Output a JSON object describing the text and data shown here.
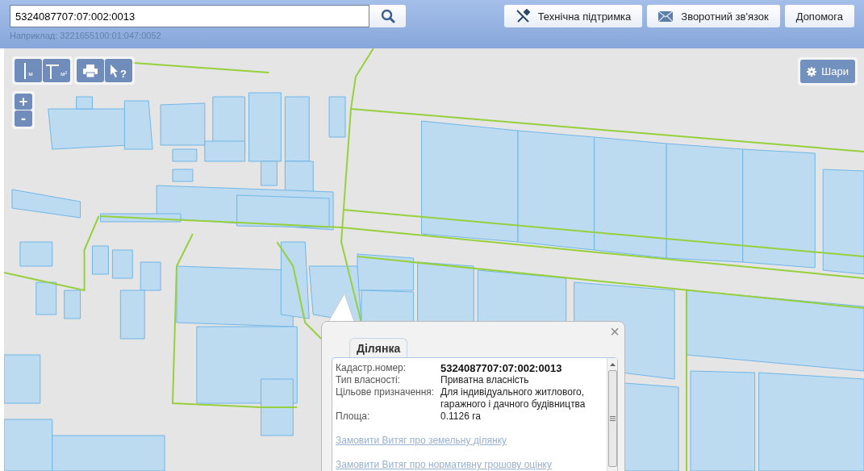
{
  "search": {
    "value": "5324087707:07:002:0013",
    "hint": "Наприклад: 3221655100:01:047:0052"
  },
  "header_buttons": [
    {
      "label": "Технічна підтримка",
      "kind": "tools"
    },
    {
      "label": "Зворотний зв'язок",
      "kind": "mail"
    },
    {
      "label": "Допомога",
      "kind": "plain"
    }
  ],
  "map_tools": [
    {
      "kind": "measure-length",
      "label": "м"
    },
    {
      "kind": "measure-area",
      "label": "м²"
    },
    {
      "kind": "print"
    },
    {
      "kind": "identify",
      "label": "?"
    }
  ],
  "zoom": {
    "in": "+",
    "out": "-"
  },
  "layers_button": "Шари",
  "popup": {
    "close": "×",
    "tabs": [
      {
        "label": "Ділянка",
        "selected": true
      }
    ],
    "fields": [
      {
        "label": "Кадастр.номер:",
        "value": "5324087707:07:002:0013",
        "bold": true
      },
      {
        "label": "Тип власності:",
        "value": "Приватна власність",
        "bold": false
      },
      {
        "label": "Цільове призначення:",
        "value": "Для індивідуального житлового, гаражного і дачного будівництва",
        "bold": false
      },
      {
        "label": "Площа:",
        "value": "0.1126 га",
        "bold": false
      }
    ],
    "links": [
      "Замовити Витяг про земельну ділянку",
      "Замовити Витяг про нормативну грошову оцінку"
    ]
  }
}
